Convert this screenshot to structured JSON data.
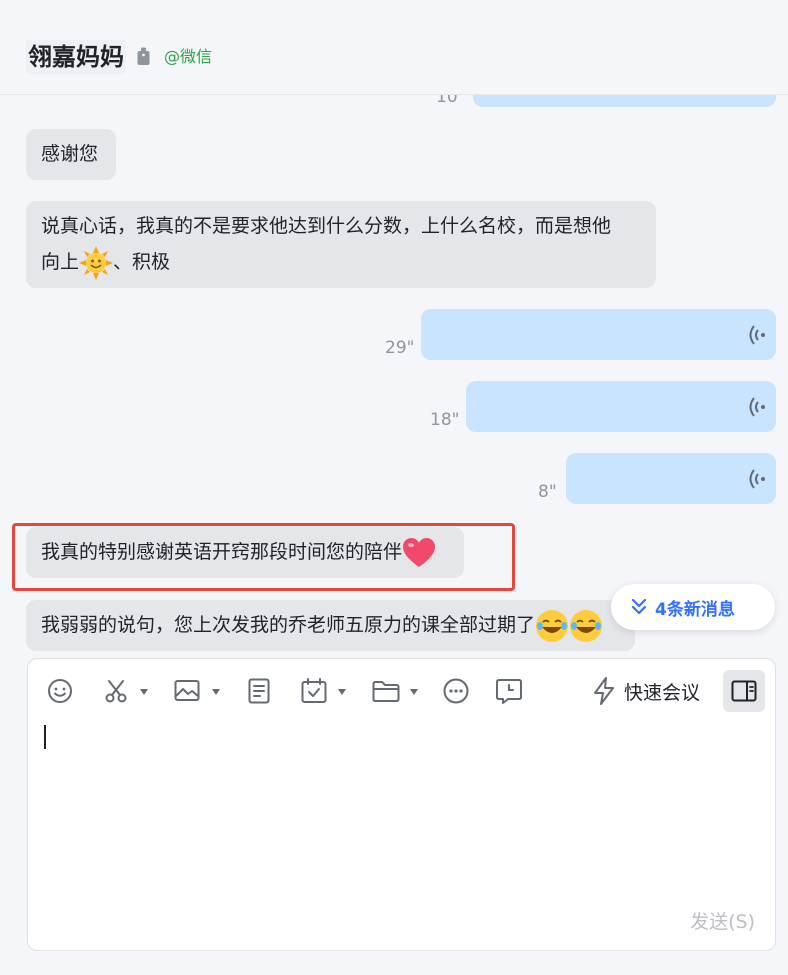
{
  "header": {
    "contact_name": "翎嘉妈妈",
    "source": "@微信"
  },
  "messages": [
    {
      "id": "partial-top",
      "direction": "out",
      "type": "voice",
      "duration": "10\""
    },
    {
      "id": "m1",
      "direction": "in",
      "type": "text",
      "text": "感谢您"
    },
    {
      "id": "m2",
      "direction": "in",
      "type": "text",
      "line1": "说真心话，我真的不是要求他达到什么分数，上什么名校，而是想他",
      "line2_before": "向上",
      "line2_after": "、积极",
      "emoji": "sun-emoji"
    },
    {
      "id": "v1",
      "direction": "out",
      "type": "voice",
      "duration": "29\""
    },
    {
      "id": "v2",
      "direction": "out",
      "type": "voice",
      "duration": "18\""
    },
    {
      "id": "v3",
      "direction": "out",
      "type": "voice",
      "duration": "8\""
    },
    {
      "id": "m3",
      "direction": "in",
      "type": "text",
      "text": "我真的特别感谢英语开窍那段时间您的陪伴",
      "emoji": "heart-emoji"
    },
    {
      "id": "m4",
      "direction": "in",
      "type": "text",
      "text": "我弱弱的说句，您上次发我的乔老师五原力的课全部过期了",
      "emoji": "tears-of-joy-emoji"
    }
  ],
  "new_messages_badge": "4条新消息",
  "composer": {
    "quick_meeting_label": "快速会议",
    "send_label": "发送(S)",
    "input_value": ""
  },
  "colors": {
    "incoming_bubble": "#e4e6ea",
    "outgoing_bubble": "#c8e4ff",
    "source_green": "#2ba245",
    "accent_blue": "#3370ff",
    "highlight_red": "#e5473d"
  }
}
